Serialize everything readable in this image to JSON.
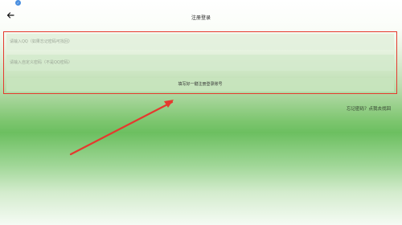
{
  "status_bar": {
    "badge_icon": "notification-badge-icon",
    "badge_color": "#4a8fe0"
  },
  "header": {
    "back_icon": "arrow-left-icon",
    "title": "注册登录"
  },
  "form": {
    "qq_placeholder": "请输入QQ（如果忘记密码可找回）",
    "qq_value": "",
    "password_placeholder": "请输入自定义密码（不是QQ密码）",
    "password_value": "",
    "submit_label": "填写好一键注册登录账号",
    "highlight_color": "#e5392e"
  },
  "forgot_password_label": "忘记密码？点我去找回",
  "annotation": {
    "arrow_icon": "red-arrow-icon",
    "color": "#e5392e"
  }
}
